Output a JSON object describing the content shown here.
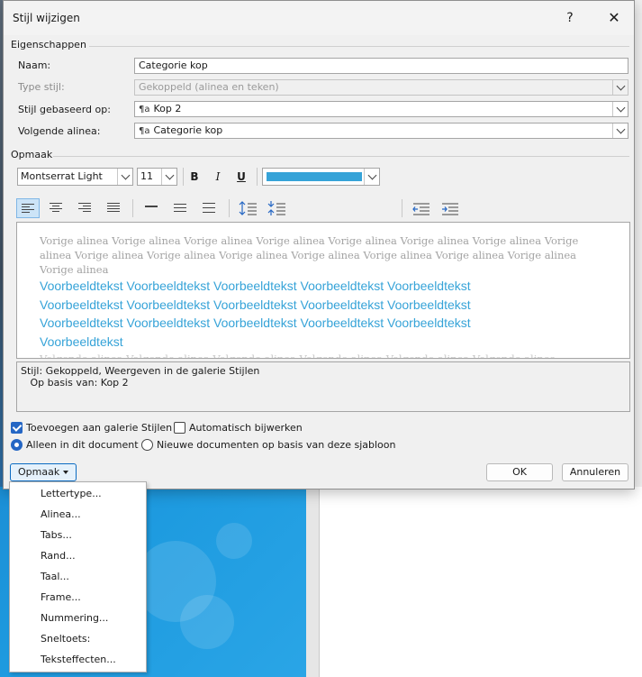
{
  "dialog": {
    "title": "Stijl wijzigen",
    "help_label": "?",
    "close_label": "✕"
  },
  "properties": {
    "section_title": "Eigenschappen",
    "name_label": "Naam:",
    "name_value": "Categorie kop",
    "type_label": "Type stijl:",
    "type_value": "Gekoppeld (alinea en teken)",
    "based_on_label": "Stijl gebaseerd op:",
    "based_on_value": "Kop 2",
    "next_label": "Volgende alinea:",
    "next_value": "Categorie kop",
    "style_glyph": "¶a"
  },
  "format": {
    "section_title": "Opmaak",
    "font_name": "Montserrat Light",
    "font_size": "11",
    "bold_label": "B",
    "italic_label": "I",
    "underline_label": "U",
    "font_color": "#36a3d8"
  },
  "preview": {
    "previous_paragraph": "Vorige alinea Vorige alinea Vorige alinea Vorige alinea Vorige alinea Vorige alinea Vorige alinea Vorige alinea Vorige alinea Vorige alinea Vorige alinea Vorige alinea Vorige alinea Vorige alinea Vorige alinea Vorige alinea",
    "sample_text": "Voorbeeldtekst Voorbeeldtekst Voorbeeldtekst Voorbeeldtekst Voorbeeldtekst Voorbeeldtekst Voorbeeldtekst Voorbeeldtekst Voorbeeldtekst Voorbeeldtekst Voorbeeldtekst Voorbeeldtekst Voorbeeldtekst Voorbeeldtekst Voorbeeldtekst Voorbeeldtekst",
    "next_paragraph": "Volgende alinea Volgende alinea Volgende alinea Volgende alinea Volgende alinea Volgende alinea"
  },
  "description": {
    "line1": "Stijl: Gekoppeld, Weergeven in de galerie Stijlen",
    "line2": "   Op basis van: Kop 2"
  },
  "options": {
    "add_gallery_label": "Toevoegen aan galerie Stijlen",
    "auto_update_label": "Automatisch bijwerken",
    "only_document_label": "Alleen in dit document",
    "new_documents_label": "Nieuwe documenten op basis van deze sjabloon"
  },
  "buttons": {
    "format_menu_label": "Opmaak",
    "ok_label": "OK",
    "cancel_label": "Annuleren"
  },
  "menu": {
    "items": [
      "Lettertype...",
      "Alinea...",
      "Tabs...",
      "Rand...",
      "Taal...",
      "Frame...",
      "Nummering...",
      "Sneltoets:",
      "Teksteffecten..."
    ]
  }
}
